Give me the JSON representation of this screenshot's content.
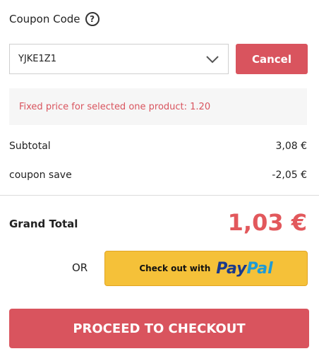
{
  "coupon": {
    "heading": "Coupon Code",
    "help_icon": "question-circle-icon",
    "selected_code": "YJKE1Z1",
    "cancel_label": "Cancel",
    "message": "Fixed price for selected one product: 1.20"
  },
  "totals": {
    "subtotal_label": "Subtotal",
    "subtotal_value": "3,08 €",
    "save_label": "coupon save",
    "save_value": "-2,05 €",
    "grand_label": "Grand Total",
    "grand_value": "1,03 €"
  },
  "checkout": {
    "or_text": "OR",
    "paypal_prefix": "Check out with",
    "paypal_pay": "Pay",
    "paypal_pal": "Pal",
    "proceed_label": "PROCEED TO CHECKOUT"
  },
  "colors": {
    "accent_red": "#d9545e",
    "grand_total_red": "#e2585c",
    "paypal_yellow": "#f5c139"
  }
}
